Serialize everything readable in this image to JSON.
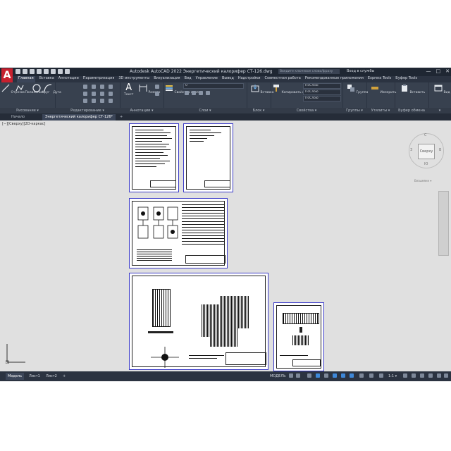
{
  "app": {
    "logo": "A",
    "title": "Autodesk AutoCAD 2022   Энергетический калорифер СТ-126.dwg",
    "search_placeholder": "Введите ключевое слово/фразу",
    "signin": "Вход в службы",
    "window_controls": [
      "—",
      "□",
      "✕"
    ]
  },
  "menu_tabs": [
    "Главная",
    "Вставка",
    "Аннотации",
    "Параметризация",
    "3D инструменты",
    "Визуализация",
    "Вид",
    "Управление",
    "Вывод",
    "Надстройки",
    "Совместная работа",
    "Рекомендованные приложения",
    "Express Tools",
    "Буфер Tools"
  ],
  "ribbon": {
    "draw": {
      "label": "Рисование ▾",
      "tools": [
        "Отрезок",
        "Полилиния",
        "Круг",
        "Дуга"
      ]
    },
    "modify": {
      "label": "Редактирование ▾"
    },
    "annotation": {
      "label": "Аннотации ▾",
      "tools": [
        "Текст",
        "Размер"
      ]
    },
    "layers": {
      "label": "Слои ▾",
      "tools": [
        "Свойства слоя"
      ],
      "layer_value": "0"
    },
    "block": {
      "label": "Блок ▾",
      "tools": [
        "Вставка"
      ]
    },
    "properties": {
      "label": "Свойства ▾",
      "tools": [
        "Копировать свойства"
      ],
      "combos": [
        "ПоСлою",
        "ПоСлою",
        "ПоСлою"
      ]
    },
    "groups": {
      "label": "Группы ▾",
      "tools": [
        "Группа"
      ]
    },
    "utilities": {
      "label": "Утилиты ▾",
      "tools": [
        "Измерить"
      ]
    },
    "clipboard": {
      "label": "Буфер обмена",
      "tools": [
        "Вставить"
      ]
    },
    "view": {
      "label": "▾",
      "tools": [
        "Вид"
      ]
    }
  },
  "doc_tabs": {
    "start": "Начало",
    "active": "Энергетический калорифер СТ-126*",
    "add": "+"
  },
  "viewport": {
    "label": "[−][Сверху][2D-каркас]",
    "viewcube_face": "Сверху",
    "viewcube_sub": "Безымянн ▾",
    "compass": {
      "n": "С",
      "s": "Ю",
      "w": "З",
      "e": "В"
    }
  },
  "status": {
    "tabs": [
      "Модель",
      "Лист1",
      "Лист2",
      "+"
    ],
    "model_label": "МОДЕЛЬ",
    "scale": "1:1 ▾"
  }
}
